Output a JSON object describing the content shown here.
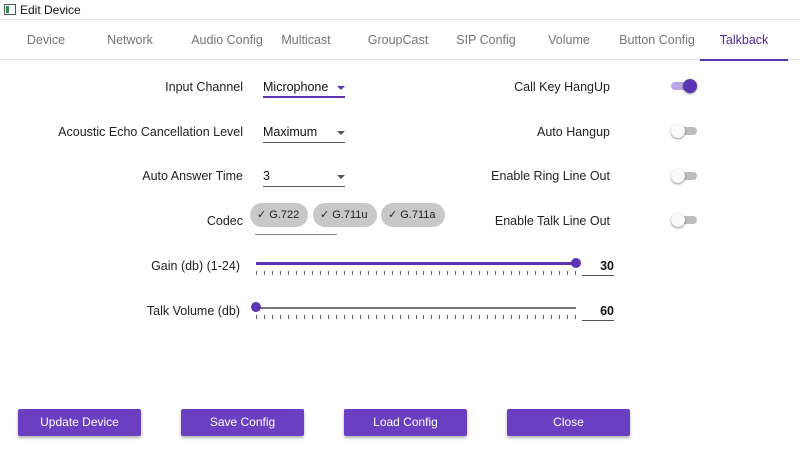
{
  "window": {
    "title": "Edit Device"
  },
  "tabs": [
    {
      "label": "Device"
    },
    {
      "label": "Network"
    },
    {
      "label": "Audio Config"
    },
    {
      "label": "Multicast"
    },
    {
      "label": "GroupCast"
    },
    {
      "label": "SIP Config"
    },
    {
      "label": "Volume"
    },
    {
      "label": "Button Config"
    },
    {
      "label": "Talkback"
    }
  ],
  "active_tab": "Talkback",
  "left": {
    "input_channel": {
      "label": "Input Channel",
      "value": "Microphone"
    },
    "aec_level": {
      "label": "Acoustic Echo Cancellation Level",
      "value": "Maximum"
    },
    "auto_answer_time": {
      "label": "Auto Answer Time",
      "value": "3"
    },
    "codec": {
      "label": "Codec",
      "chips": [
        {
          "label": "G.722"
        },
        {
          "label": "G.711u"
        },
        {
          "label": "G.711a"
        }
      ]
    }
  },
  "right": {
    "call_key_hangup": {
      "label": "Call Key HangUp",
      "on": true
    },
    "auto_hangup": {
      "label": "Auto Hangup",
      "on": false
    },
    "enable_ring_line_out": {
      "label": "Enable Ring Line Out",
      "on": false
    },
    "enable_talk_line_out": {
      "label": "Enable Talk Line Out",
      "on": false
    }
  },
  "gain": {
    "label": "Gain (db) (1-24)",
    "value": "30",
    "fraction": 1.0
  },
  "talk_volume": {
    "label": "Talk Volume (db)",
    "value": "60",
    "fraction": 0.0
  },
  "buttons": {
    "update_device": "Update Device",
    "save_config": "Save Config",
    "load_config": "Load Config",
    "close": "Close"
  },
  "colors": {
    "accent": "#5b35b5",
    "button": "#6a3fc1"
  }
}
